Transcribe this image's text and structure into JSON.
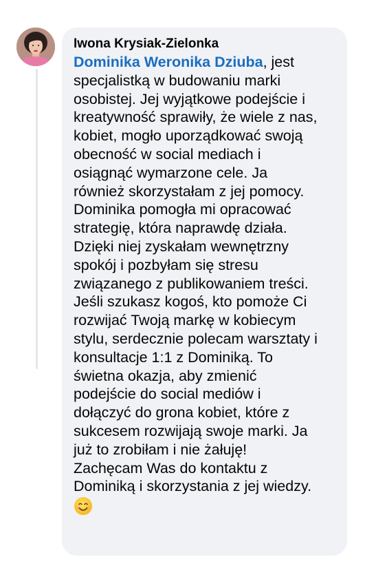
{
  "comment": {
    "author": "Iwona Krysiak-Zielonka",
    "mention": "Dominika Weronika Dziuba",
    "first_line_rest": ", jest",
    "lines": [
      "specjalistką w budowaniu marki",
      "osobistej. Jej wyjątkowe podejście i",
      "kreatywność sprawiły, że wiele z nas,",
      "kobiet, mogło uporządkować swoją",
      "obecność w social mediach i",
      "osiągnąć wymarzone cele. Ja",
      "również skorzystałam z jej pomocy.",
      "Dominika pomogła mi opracować",
      "strategię, która naprawdę działa.",
      "Dzięki niej zyskałam wewnętrzny",
      "spokój i pozbyłam się stresu",
      "związanego z publikowaniem treści.",
      "Jeśli szukasz kogoś, kto pomoże Ci",
      "rozwijać Twoją markę w kobiecym",
      "stylu, serdecznie polecam warsztaty i",
      "konsultacje 1:1 z Dominiką. To",
      "świetna okazja, aby zmienić",
      "podejście do social mediów i",
      "dołączyć do grona kobiet, które z",
      "sukcesem rozwijają swoje marki. Ja",
      "już to zrobiłam i nie żałuję!",
      "Zachęcam Was do kontaktu z",
      "Dominiką i skorzystania z jej wiedzy."
    ],
    "emoji": "smiling-face-emoji"
  },
  "colors": {
    "bubble_background": "#f0f2f5",
    "mention": "#1a6ec2",
    "thread_line": "#e4e6eb"
  }
}
